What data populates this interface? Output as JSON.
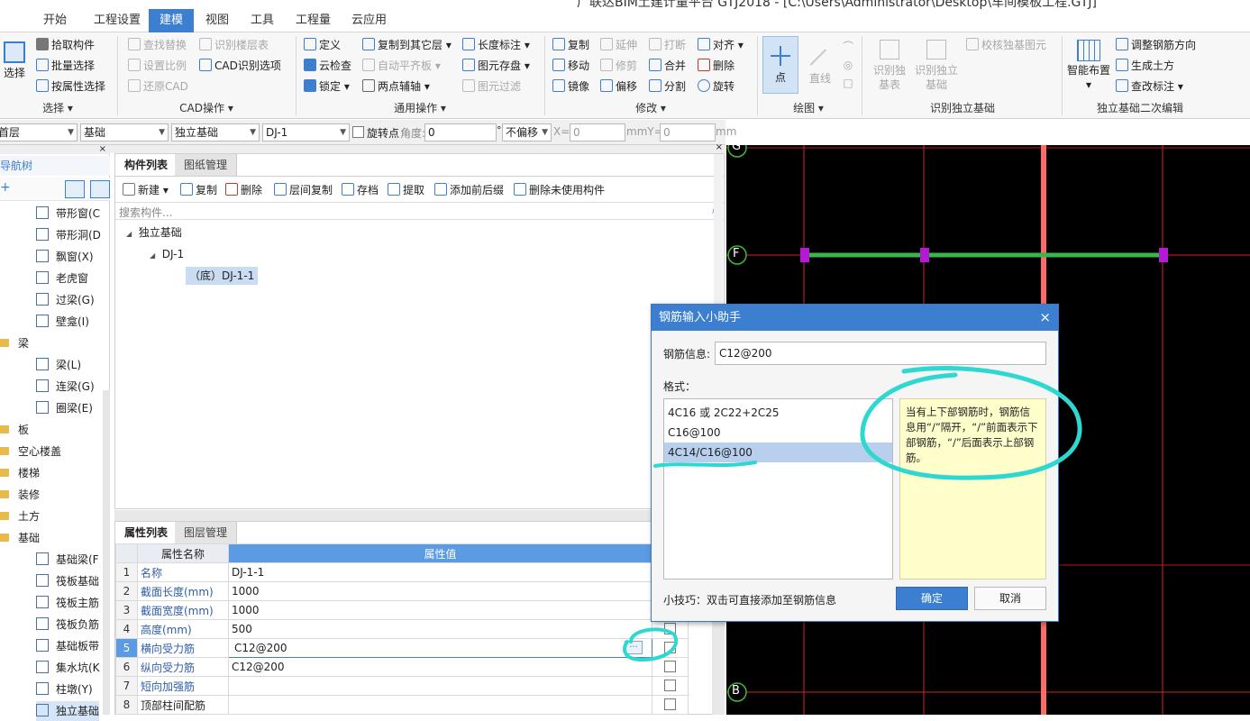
{
  "window": {
    "title": "广联达BIM土建计量平台 GTJ2018 - [C:\\Users\\Administrator\\Desktop\\车间模板工程.GTJ]"
  },
  "menu": [
    "开始",
    "工程设置",
    "建模",
    "视图",
    "工具",
    "工程量",
    "云应用"
  ],
  "menu_active": "建模",
  "ribbon": {
    "select": {
      "big": "选择",
      "items": [
        "拾取构件",
        "批量选择",
        "按属性选择"
      ],
      "group": "选择"
    },
    "cad": {
      "items": [
        "查找替换",
        "识别楼层表",
        "设置比例",
        "CAD识别选项",
        "还原CAD"
      ],
      "group": "CAD操作"
    },
    "common": {
      "items": [
        "定义",
        "复制到其它层",
        "长度标注",
        "云检查",
        "自动平齐板",
        "图元存盘",
        "锁定",
        "两点辅轴",
        "图元过滤"
      ],
      "group": "通用操作"
    },
    "modify": {
      "items": [
        "复制",
        "延伸",
        "打断",
        "对齐",
        "移动",
        "修剪",
        "合并",
        "删除",
        "镜像",
        "偏移",
        "分割",
        "旋转"
      ],
      "group": "修改"
    },
    "draw": {
      "items": [
        "点",
        "直线"
      ],
      "group": "绘图"
    },
    "recognize": {
      "items": [
        "识别独基表",
        "识别独立基础",
        "校核独基图元"
      ],
      "group": "识别独立基础"
    },
    "edit2": {
      "big": "智能布置",
      "items": [
        "调整钢筋方向",
        "生成土方",
        "查改标注"
      ],
      "group": "独立基础二次编辑"
    }
  },
  "propbar": {
    "floor": "首层",
    "category": "基础",
    "type": "独立基础",
    "component": "DJ-1",
    "rotate_label": "旋转点",
    "angle_label": "角度:",
    "angle_value": "0",
    "angle_unit": "°",
    "offset_mode": "不偏移",
    "x_label": "X=",
    "x_value": "0",
    "y_label": "mmY=",
    "y_value": "0",
    "unit": "mm"
  },
  "nav": {
    "title": "导航树",
    "items": [
      "带形窗(C",
      "带形洞(D",
      "飘窗(X)",
      "老虎窗",
      "过梁(G)",
      "壁龛(I)"
    ],
    "beam_cat": "梁",
    "beam_items": [
      "梁(L)",
      "连梁(G)",
      "圈梁(E)"
    ],
    "categories": [
      "板",
      "空心楼盖",
      "楼梯",
      "装修",
      "土方",
      "基础"
    ],
    "foundation_items": [
      "基础梁(F",
      "筏板基础",
      "筏板主筋",
      "筏板负筋",
      "基础板带",
      "集水坑(K",
      "柱墩(Y)",
      "独立基础"
    ]
  },
  "component_panel": {
    "tabs": [
      "构件列表",
      "图纸管理"
    ],
    "toolbar": [
      "新建",
      "复制",
      "删除",
      "层间复制",
      "存档",
      "提取",
      "添加前后缀",
      "删除未使用构件"
    ],
    "search_placeholder": "搜索构件...",
    "tree": {
      "root": "独立基础",
      "child": "DJ-1",
      "leaf": "（底）DJ-1-1"
    }
  },
  "property_panel": {
    "tabs": [
      "属性列表",
      "图层管理"
    ],
    "headers": [
      "属性名称",
      "属性值"
    ],
    "rows": [
      {
        "num": "1",
        "name": "名称",
        "value": "DJ-1-1"
      },
      {
        "num": "2",
        "name": "截面长度(mm)",
        "value": "1000"
      },
      {
        "num": "3",
        "name": "截面宽度(mm)",
        "value": "1000"
      },
      {
        "num": "4",
        "name": "高度(mm)",
        "value": "500"
      },
      {
        "num": "5",
        "name": "横向受力筋",
        "value": "C12@200"
      },
      {
        "num": "6",
        "name": "纵向受力筋",
        "value": "C12@200"
      },
      {
        "num": "7",
        "name": "短向加强筋",
        "value": ""
      },
      {
        "num": "8",
        "name": "顶部柱间配筋",
        "value": ""
      }
    ],
    "ellipsis": "···"
  },
  "canvas": {
    "axes": [
      "G",
      "F",
      "B"
    ]
  },
  "dialog": {
    "title": "钢筋输入小助手",
    "info_label": "钢筋信息:",
    "info_value": "C12@200",
    "format_label": "格式：",
    "formats": [
      "4C16 或 2C22+2C25",
      "C16@100",
      "4C14/C16@100"
    ],
    "help": "当有上下部钢筋时，钢筋信息用“/”隔开，“/”前面表示下部钢筋，“/”后面表示上部钢筋。",
    "tip": "小技巧：双击可直接添加至钢筋信息",
    "ok": "确定",
    "cancel": "取消"
  },
  "colors": {
    "accent": "#3c7fd0",
    "annotation": "#2ed8d0",
    "beam": "#39b54a",
    "node": "#b41ad6",
    "axis_red": "#d8242b"
  }
}
